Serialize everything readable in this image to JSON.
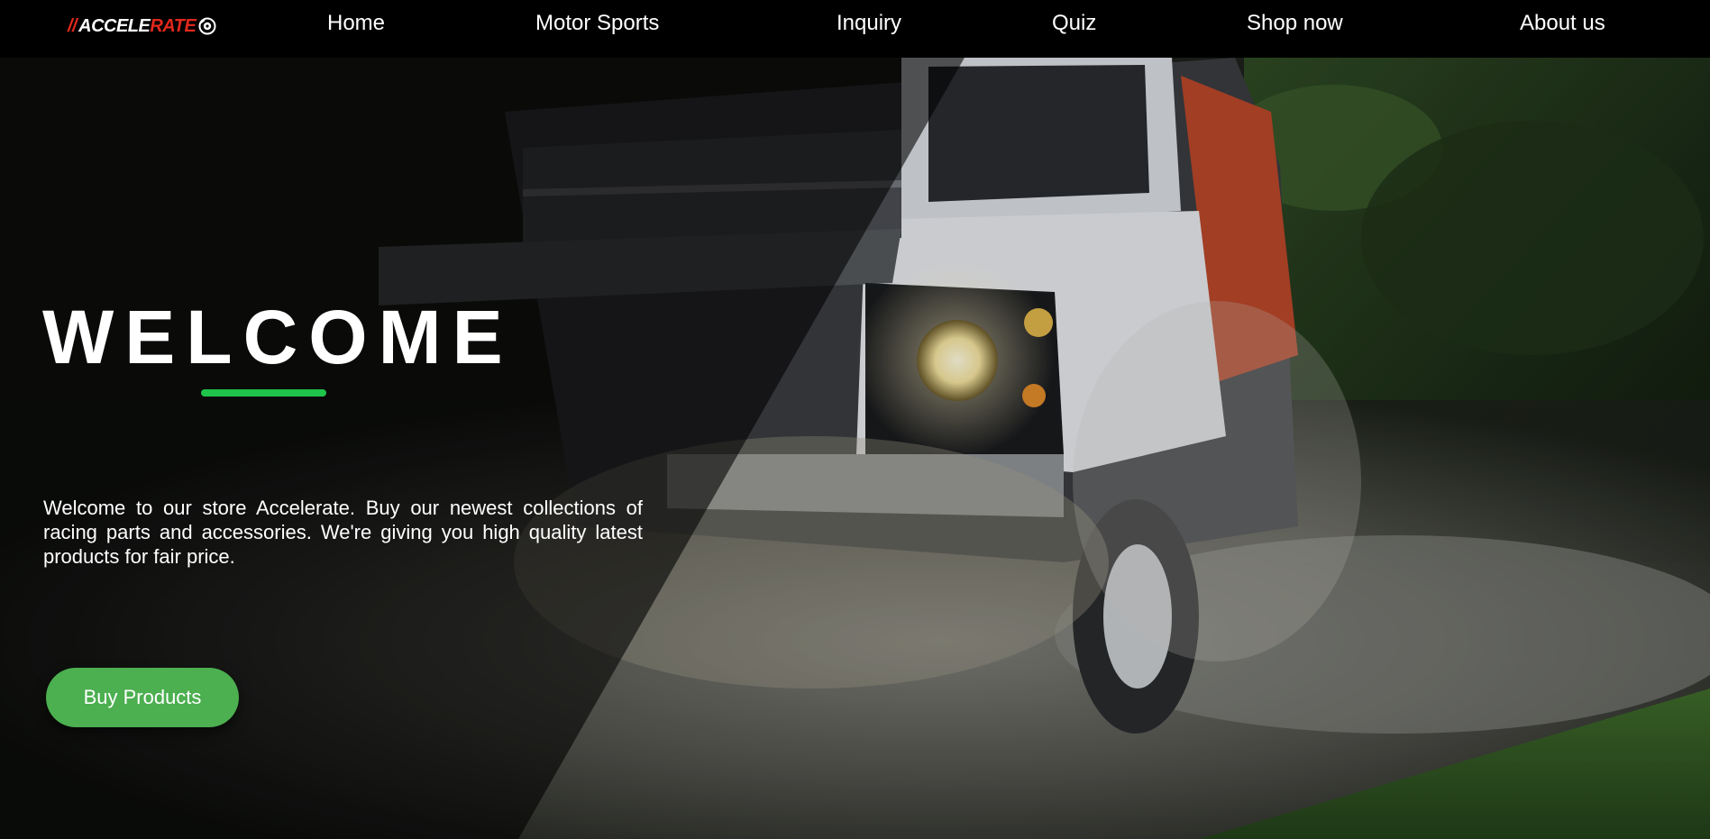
{
  "brand": {
    "prefix": "//",
    "name_part1": "ACCELE",
    "name_part2": "RATE",
    "accent_color": "#e0281c",
    "icon": "wheel-icon"
  },
  "nav": {
    "items": [
      {
        "label": "Home"
      },
      {
        "label": "Motor Sports"
      },
      {
        "label": "Inquiry"
      },
      {
        "label": "Quiz"
      },
      {
        "label": "Shop now"
      },
      {
        "label": "About us"
      }
    ]
  },
  "hero": {
    "title": "WELCOME",
    "underline_color": "#1fc44a",
    "description": "Welcome to our store Accelerate. Buy our newest collections of racing parts and accessories. We're giving you high quality latest products for fair price.",
    "cta_label": "Buy Products",
    "cta_color": "#4caf50"
  }
}
